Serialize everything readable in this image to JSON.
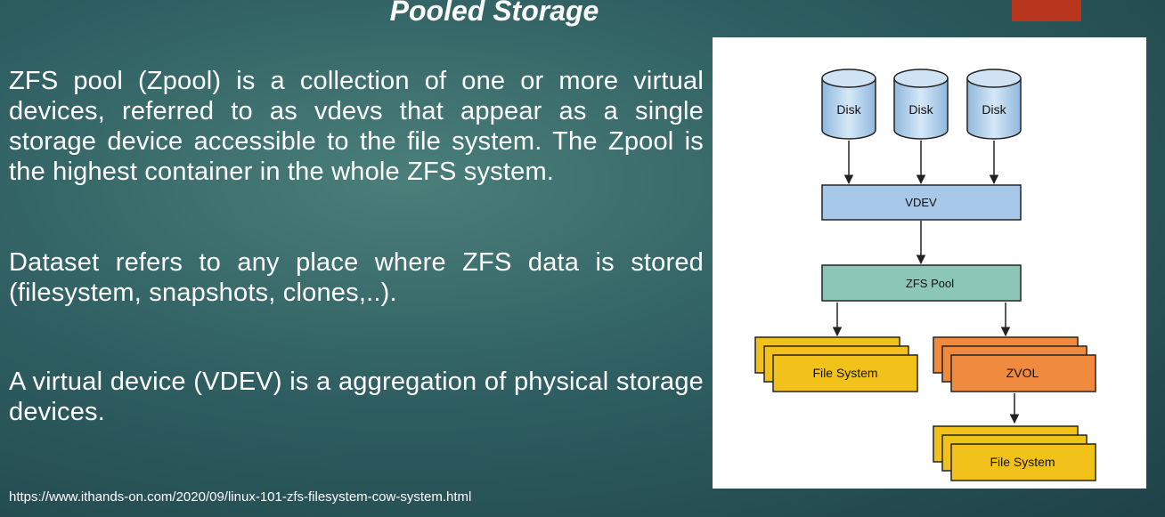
{
  "slide": {
    "title": "Pooled Storage",
    "paragraphs": [
      "ZFS pool (Zpool) is a collection of one or more virtual devices, referred to as vdevs that appear as a single storage device accessible to the file system. The Zpool is the highest container in the whole ZFS system.",
      "Dataset refers to any place where ZFS data is stored (filesystem, snapshots, clones,..).",
      "A virtual device (VDEV) is a aggregation of physical storage devices."
    ],
    "source_url": "https://www.ithands-on.com/2020/09/linux-101-zfs-filesystem-cow-system.html"
  },
  "diagram": {
    "disks": [
      "Disk",
      "Disk",
      "Disk"
    ],
    "vdev_label": "VDEV",
    "pool_label": "ZFS Pool",
    "filesystem_label": "File System",
    "zvol_label": "ZVOL",
    "zvol_filesystem_label": "File System"
  },
  "colors": {
    "disk_blue": "#b9d6ef",
    "vdev_blue": "#a8c8ea",
    "pool_teal": "#8cc6b6",
    "filesystem_yellow": "#f2c21b",
    "zvol_orange": "#f08a3e",
    "badge_red": "#b8351e"
  }
}
